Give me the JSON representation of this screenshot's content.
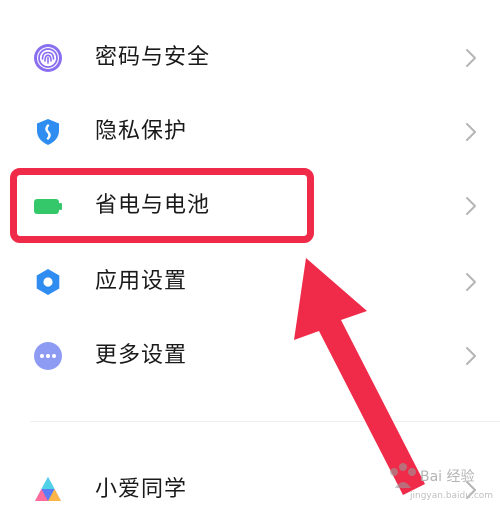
{
  "settings": {
    "items": [
      {
        "label": "密码与安全",
        "icon": "fingerprint-icon",
        "color": "#8a6ff0"
      },
      {
        "label": "隐私保护",
        "icon": "privacy-shield-icon",
        "color": "#2f8cf0"
      },
      {
        "label": "省电与电池",
        "icon": "battery-icon",
        "color": "#35c86a"
      },
      {
        "label": "应用设置",
        "icon": "gear-icon",
        "color": "#2f8cf0"
      },
      {
        "label": "更多设置",
        "icon": "more-dots-icon",
        "color": "#8e9bf3"
      },
      {
        "label": "小爱同学",
        "icon": "xiaoai-logo-icon",
        "color": "#5a7cf7"
      }
    ]
  },
  "annotation": {
    "highlight_color": "#ef2b49",
    "arrow_color": "#ef2b49"
  },
  "watermark": {
    "text": "Bai 经验",
    "url": "jingyan.baidu.com"
  }
}
